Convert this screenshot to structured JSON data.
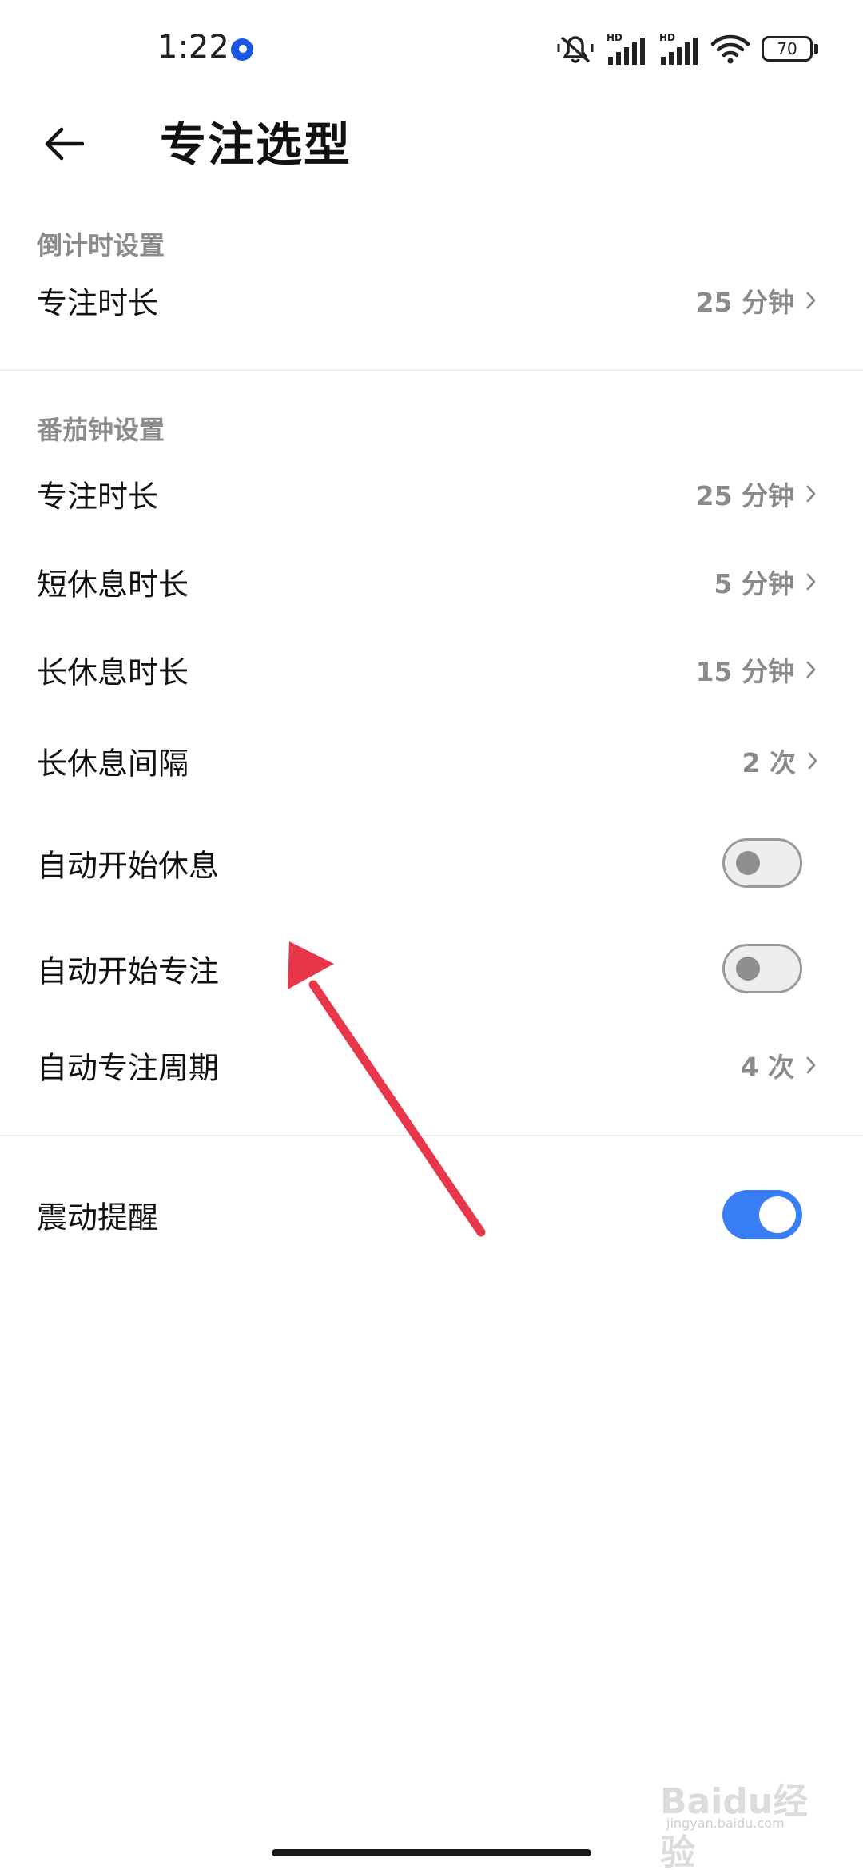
{
  "status_bar": {
    "time": "1:22",
    "network_badges": [
      "HD",
      "HD"
    ],
    "battery": "70",
    "icons": [
      "mute-icon",
      "signal-icon",
      "signal-icon",
      "wifi-icon",
      "battery-icon"
    ],
    "notif_color": "#1a56e8"
  },
  "header": {
    "title": "专注选型"
  },
  "countdown": {
    "section_label": "倒计时设置",
    "rows": [
      {
        "label": "专注时长",
        "value": "25 分钟"
      }
    ]
  },
  "pomodoro": {
    "section_label": "番茄钟设置",
    "rows": [
      {
        "label": "专注时长",
        "value": "25 分钟"
      },
      {
        "label": "短休息时长",
        "value": "5 分钟"
      },
      {
        "label": "长休息时长",
        "value": "15 分钟"
      },
      {
        "label": "长休息间隔",
        "value": "2 次"
      }
    ],
    "toggles": [
      {
        "label": "自动开始休息",
        "on": false
      },
      {
        "label": "自动开始专注",
        "on": false
      }
    ],
    "cycle": {
      "label": "自动专注周期",
      "value": "4 次"
    }
  },
  "other": {
    "vibration": {
      "label": "震动提醒",
      "on": true
    }
  },
  "colors": {
    "accent": "#3a7ef5",
    "annotation_arrow": "#e8374a"
  },
  "watermark": {
    "text": "Baidu经验",
    "sub": "jingyan.baidu.com"
  }
}
